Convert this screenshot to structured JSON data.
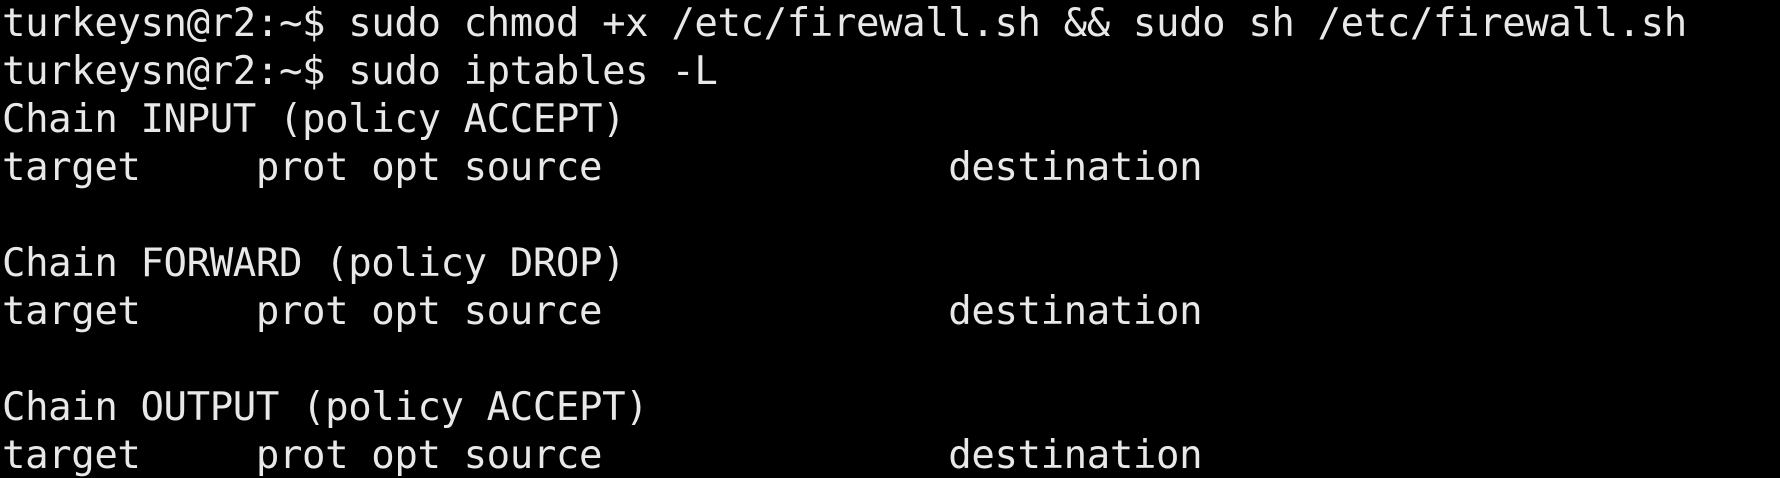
{
  "terminal": {
    "lines": [
      "turkeysn@r2:~$ sudo chmod +x /etc/firewall.sh && sudo sh /etc/firewall.sh",
      "turkeysn@r2:~$ sudo iptables -L",
      "Chain INPUT (policy ACCEPT)",
      "target     prot opt source               destination",
      "",
      "Chain FORWARD (policy DROP)",
      "target     prot opt source               destination",
      "",
      "Chain OUTPUT (policy ACCEPT)",
      "target     prot opt source               destination"
    ]
  },
  "colors": {
    "background": "#000000",
    "foreground": "#e8e8e8"
  }
}
